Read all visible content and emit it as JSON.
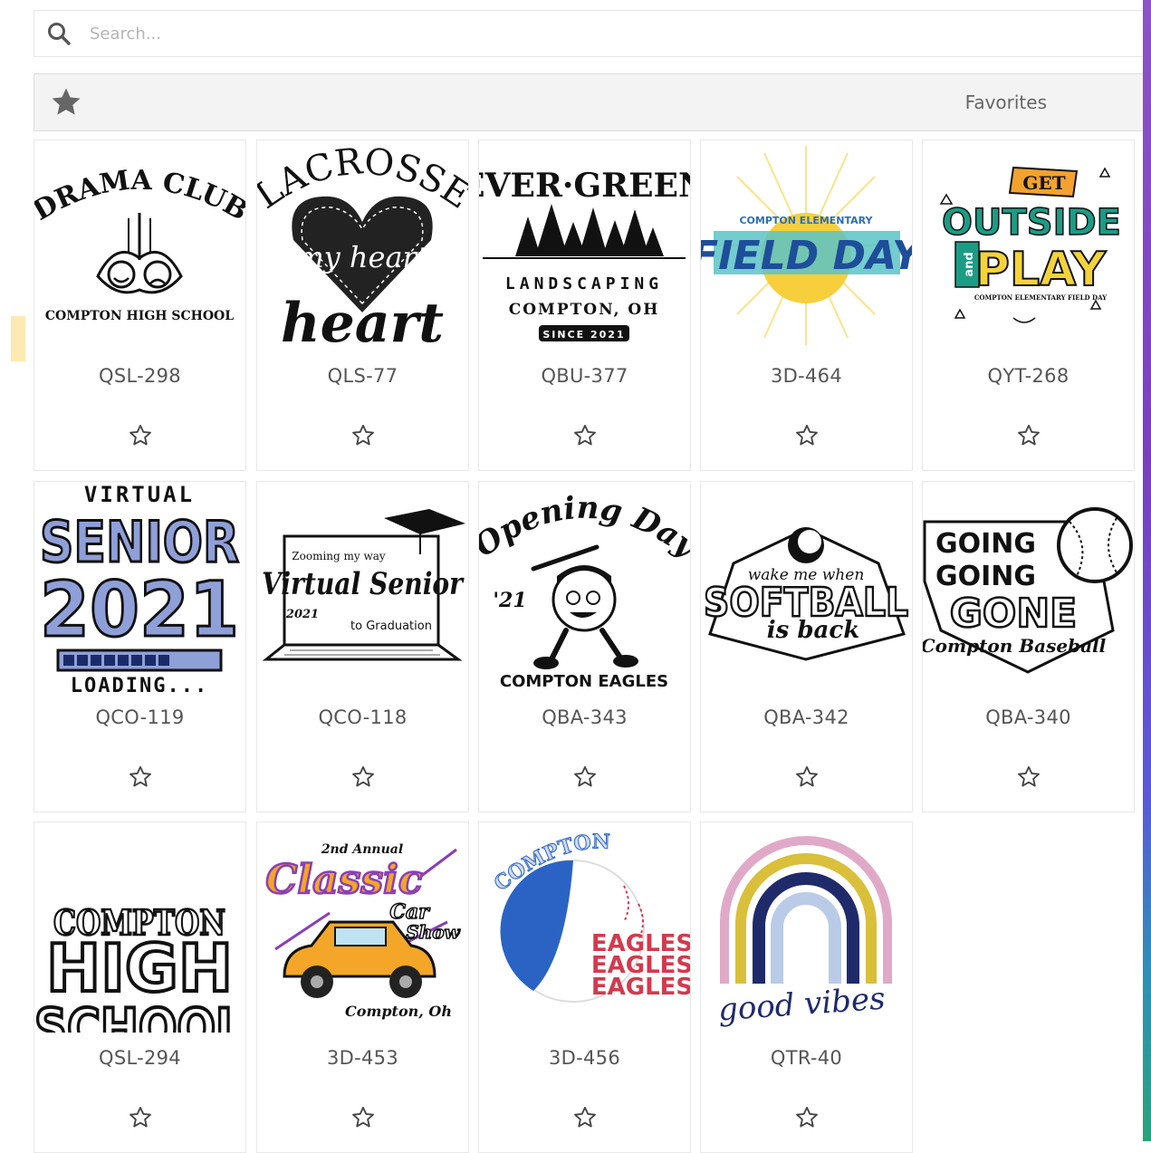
{
  "search": {
    "placeholder": "Search..."
  },
  "favorites": {
    "label": "Favorites"
  },
  "designs": [
    {
      "code": "QSL-298",
      "lines": [
        "DRAMA CLUB",
        "COMPTON HIGH SCHOOL"
      ]
    },
    {
      "code": "QLS-77",
      "lines": [
        "LACROSSE",
        "my heart"
      ]
    },
    {
      "code": "QBU-377",
      "lines": [
        "EVER·GREEN",
        "LANDSCAPING",
        "COMPTON, OH",
        "SINCE 2021"
      ]
    },
    {
      "code": "3D-464",
      "lines": [
        "COMPTON ELEMENTARY",
        "FIELD DAY"
      ]
    },
    {
      "code": "QYT-268",
      "lines": [
        "GET",
        "OUTSIDE",
        "and",
        "PLAY",
        "COMPTON ELEMENTARY FIELD DAY"
      ]
    },
    {
      "code": "QCO-119",
      "lines": [
        "VIRTUAL",
        "SENIOR",
        "2021",
        "LOADING..."
      ]
    },
    {
      "code": "QCO-118",
      "lines": [
        "Zooming my way",
        "Virtual Senior",
        "2021",
        "to Graduation"
      ]
    },
    {
      "code": "QBA-343",
      "lines": [
        "Opening Day",
        "'21",
        "COMPTON EAGLES"
      ]
    },
    {
      "code": "QBA-342",
      "lines": [
        "wake me when",
        "SOFTBALL",
        "is back"
      ]
    },
    {
      "code": "QBA-340",
      "lines": [
        "GOING",
        "GOING",
        "GONE",
        "Compton Baseball"
      ]
    },
    {
      "code": "QSL-294",
      "lines": [
        "COMPTON",
        "HIGH",
        "SCHOOL"
      ]
    },
    {
      "code": "3D-453",
      "lines": [
        "2nd Annual",
        "Classic",
        "Car",
        "Show",
        "Compton, Oh"
      ]
    },
    {
      "code": "3D-456",
      "lines": [
        "COMPTON",
        "EAGLES",
        "EAGLES",
        "EAGLES"
      ]
    },
    {
      "code": "QTR-40",
      "lines": [
        "good vibes"
      ]
    }
  ],
  "colors": {
    "senior_blue": "#8f9fd8",
    "field_yellow": "#f7cf3c",
    "field_teal": "#5ac3c6",
    "outside_green": "#1b9c85",
    "outside_orange": "#f3a230",
    "outside_yellow": "#f4d33a",
    "classic_purple": "#8a3fb5",
    "classic_orange": "#f3a628",
    "eagles_blue": "#2a63c4",
    "eagles_red": "#d23a4e",
    "rainbow_pink": "#e0a9c8",
    "rainbow_yellow": "#d9bf3a",
    "rainbow_navy": "#1f2a6b",
    "rainbow_blue": "#b9cbe6"
  }
}
